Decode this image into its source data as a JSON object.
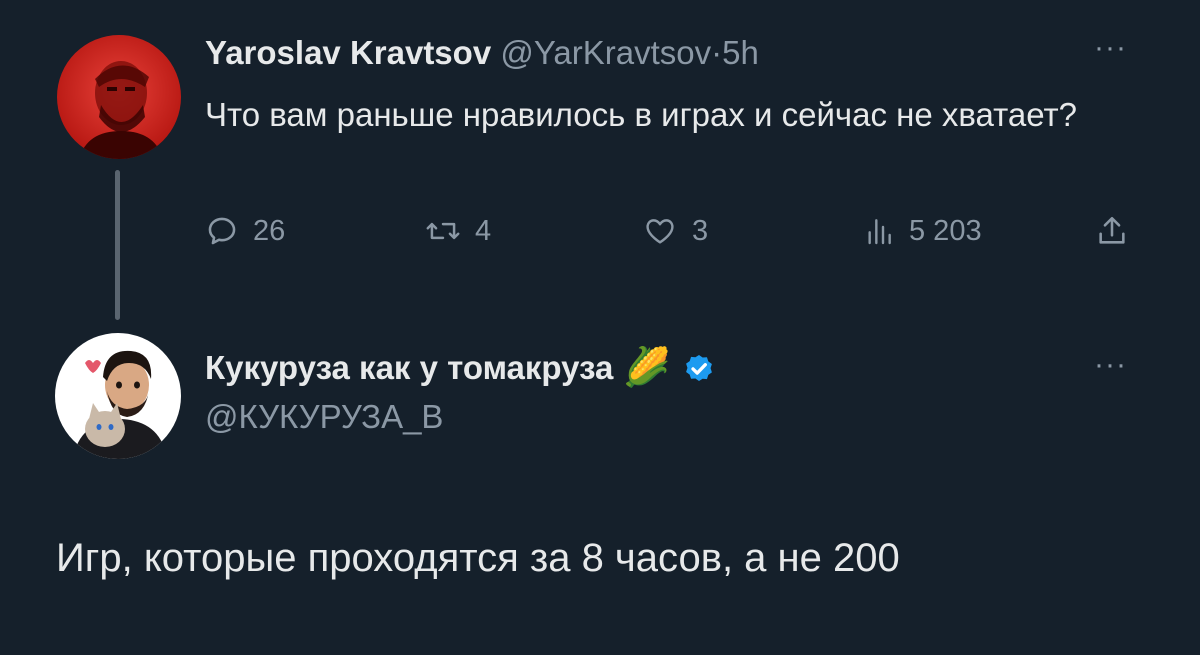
{
  "tweets": [
    {
      "author_name": "Yaroslav Kravtsov",
      "handle": "@YarKravtsov",
      "time": "5h",
      "separator": "·",
      "text": "Что вам раньше нравилось в играх и сейчас не хватает?",
      "replies": "26",
      "retweets": "4",
      "likes": "3",
      "views": "5 203",
      "avatar_icon": "red-tinted-portrait-avatar"
    },
    {
      "author_name": "Кукуруза как у томакруза",
      "name_emoji": "🌽",
      "verified": true,
      "handle": "@КУКУРУЗА_В",
      "text": "Игр, которые проходятся за 8 часов, а не 200",
      "avatar_icon": "cartoon-man-with-cat-avatar"
    }
  ],
  "more_label": "···",
  "colors": {
    "background": "#15202b",
    "text": "#e7e9ea",
    "muted": "#8b98a5",
    "verified": "#1d9bf0",
    "thread_line": "#5a6570"
  }
}
